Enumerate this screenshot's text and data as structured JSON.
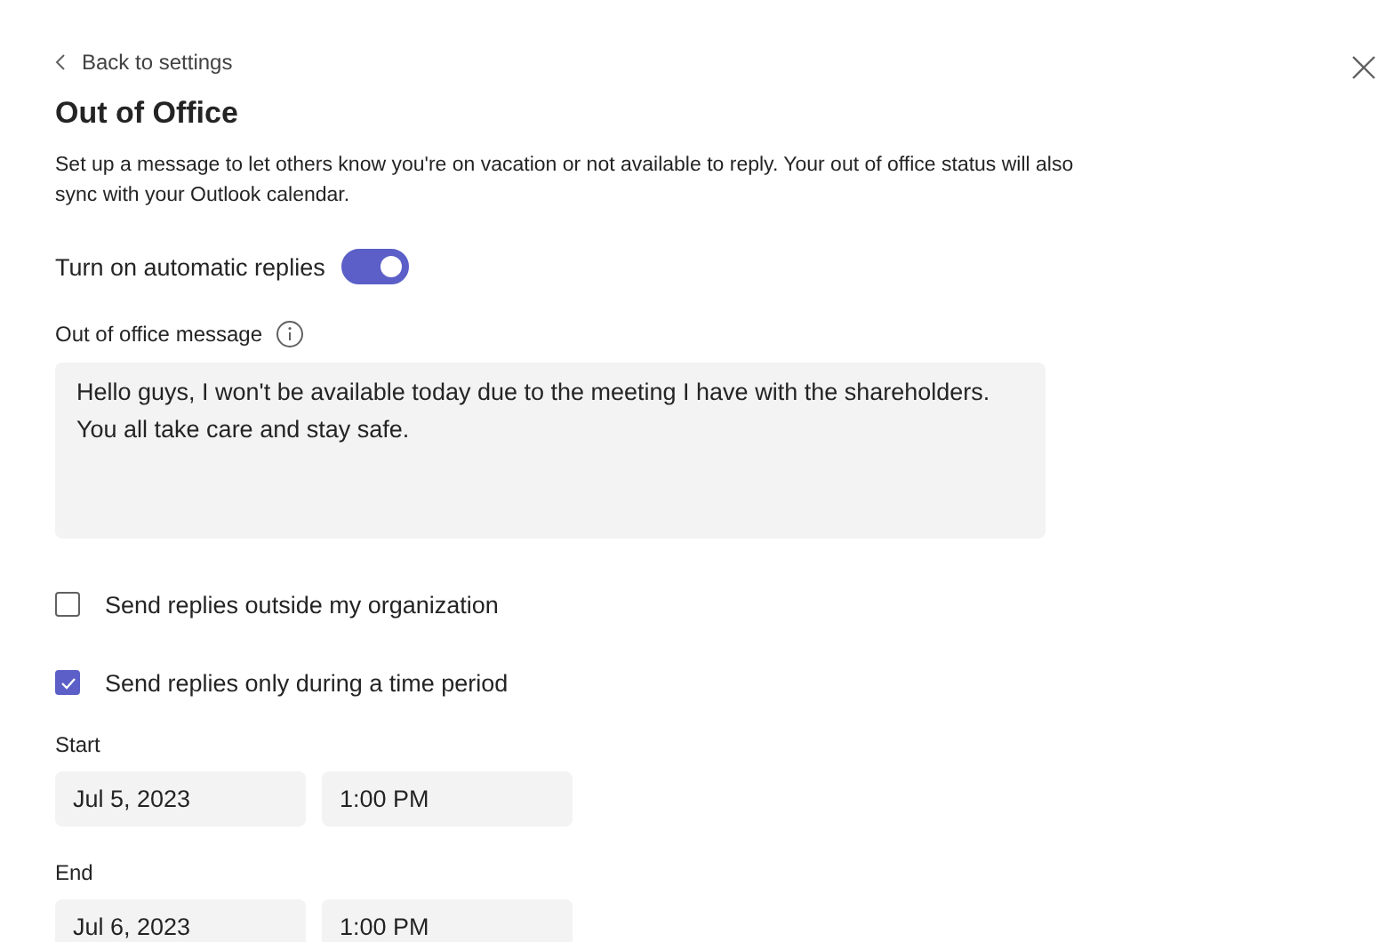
{
  "back_link": "Back to settings",
  "title": "Out of Office",
  "description": "Set up a message to let others know you're on vacation or not available to reply. Your out of office status will also sync with your Outlook calendar.",
  "auto_reply": {
    "label": "Turn on automatic replies",
    "on": true
  },
  "message": {
    "label": "Out of office message",
    "value": "Hello guys, I won't be available today due to the meeting I have with the shareholders.\nYou all take care and stay safe."
  },
  "options": [
    {
      "label": "Send replies outside my organization",
      "checked": false
    },
    {
      "label": "Send replies only during a time period",
      "checked": true
    }
  ],
  "periods": [
    {
      "label": "Start",
      "date": "Jul 5, 2023",
      "time": "1:00 PM"
    },
    {
      "label": "End",
      "date": "Jul 6, 2023",
      "time": "1:00 PM"
    }
  ]
}
